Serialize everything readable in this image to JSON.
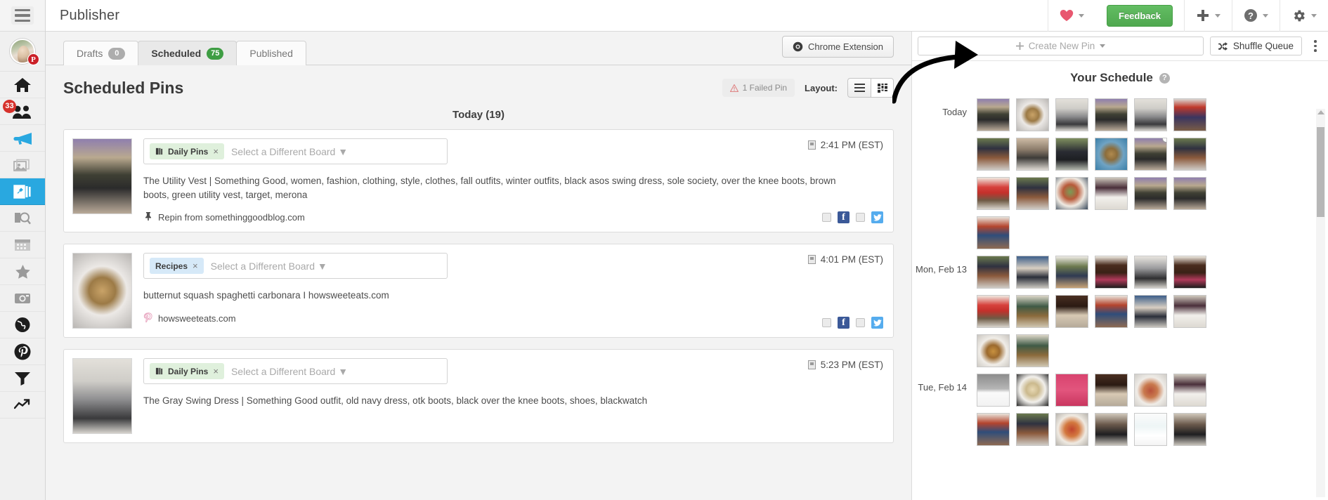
{
  "header": {
    "title": "Publisher",
    "hamburger_icon": "hamburger-menu-icon",
    "heart_icon": "heart-icon",
    "feedback_label": "Feedback",
    "plus_icon": "plus-icon",
    "help_icon": "question-circle-icon",
    "gear_icon": "gear-icon",
    "feedback_color": "#5cb85c",
    "heart_color": "#e8576f"
  },
  "sidebar": {
    "avatar": {
      "name": "user-avatar",
      "badge_icon": "pinterest-badge-icon"
    },
    "items": [
      {
        "name": "home",
        "icon": "home-icon",
        "badge": "",
        "active": false
      },
      {
        "name": "community",
        "icon": "people-icon",
        "badge": "33",
        "active": false
      },
      {
        "name": "announcements",
        "icon": "megaphone-icon",
        "badge": "",
        "active": false
      },
      {
        "name": "image-library",
        "icon": "photos-icon",
        "badge": "",
        "active": false
      },
      {
        "name": "publisher",
        "icon": "pin-board-icon",
        "badge": "",
        "active": true
      },
      {
        "name": "content-search",
        "icon": "content-search-icon",
        "badge": "",
        "active": false
      },
      {
        "name": "calendar",
        "icon": "calendar-icon",
        "badge": "",
        "active": false
      },
      {
        "name": "favorites",
        "icon": "star-icon",
        "badge": "",
        "active": false
      },
      {
        "name": "instagram",
        "icon": "camera-icon",
        "badge": "",
        "active": false
      },
      {
        "name": "web",
        "icon": "globe-icon",
        "badge": "",
        "active": false
      },
      {
        "name": "pinterest",
        "icon": "pinterest-icon",
        "badge": "",
        "active": false
      },
      {
        "name": "filter",
        "icon": "funnel-icon",
        "badge": "",
        "active": false
      },
      {
        "name": "analytics",
        "icon": "trending-up-icon",
        "badge": "",
        "active": false
      }
    ]
  },
  "tabs": [
    {
      "label": "Drafts",
      "count": "0",
      "active": false,
      "count_color": "#adadad"
    },
    {
      "label": "Scheduled",
      "count": "75",
      "active": true,
      "count_color": "#3e9d43"
    },
    {
      "label": "Published",
      "count": "",
      "active": false,
      "count_color": ""
    }
  ],
  "toolbar": {
    "chrome_extension_label": "Chrome Extension",
    "chrome_icon": "chrome-icon"
  },
  "section": {
    "title": "Scheduled Pins",
    "failed_pin_label": "1 Failed Pin",
    "failed_pin_icon": "warning-triangle-icon",
    "layout_label": "Layout:",
    "layout_list_icon": "list-view-icon",
    "layout_grid_icon": "grid-view-icon",
    "day_heading": "Today (19)"
  },
  "pins": [
    {
      "board": "Daily Pins",
      "board_color": "green",
      "board_icon": "pinterest-board-icon",
      "remove_label": "×",
      "board_placeholder": "Select a Different Board",
      "description": "The Utility Vest | Something Good, women, fashion, clothing, style, clothes, fall outfits, winter outfits, black asos swing dress, sole society, over the knee boots, brown boots, green utility vest, target, merona",
      "source_icon": "repin-icon",
      "source": "Repin from somethinggoodblog.com",
      "time": "2:41 PM (EST)",
      "time_icon": "clock-icon",
      "facebook_label": "f",
      "thumb_style": "outfit-green-jacket"
    },
    {
      "board": "Recipes",
      "board_color": "blue",
      "board_icon": "",
      "remove_label": "×",
      "board_placeholder": "Select a Different Board",
      "description": "butternut squash spaghetti carbonara I howsweeteats.com",
      "source_icon": "pinterest-outline-icon",
      "source": "howsweeteats.com",
      "time": "4:01 PM (EST)",
      "time_icon": "clock-icon",
      "facebook_label": "f",
      "thumb_style": "pasta-plate"
    },
    {
      "board": "Daily Pins",
      "board_color": "green",
      "board_icon": "pinterest-board-icon",
      "remove_label": "×",
      "board_placeholder": "Select a Different Board",
      "description": "The Gray Swing Dress | Something Good outfit, old navy dress, otk boots, black over the knee boots, shoes, blackwatch",
      "source_icon": "repin-icon",
      "source": "",
      "time": "5:23 PM (EST)",
      "time_icon": "clock-icon",
      "facebook_label": "f",
      "thumb_style": "outfit-gray-dress"
    }
  ],
  "schedule": {
    "create_pin_label": "Create New Pin",
    "create_pin_icon": "plus-icon",
    "shuffle_label": "Shuffle Queue",
    "shuffle_icon": "shuffle-icon",
    "kebab_icon": "more-vertical-icon",
    "title": "Your Schedule",
    "help_icon": "question-mark-icon",
    "days": [
      {
        "label": "Today",
        "rows": [
          [
            "outfit-green-jacket",
            "pasta-plate",
            "outfit-gray-dress",
            "outfit-green-jacket",
            "outfit-gray-dress",
            "red-hat-sitting"
          ],
          [
            "boots-brown",
            "street-walk",
            "boots-black-step",
            "bowl-blue-plate",
            "outfit-green-jacket",
            "boots-brown"
          ],
          [
            "strawberry-dessert",
            "boots-brown",
            "plate-breakfast",
            "white-pants-outfit",
            "outfit-green-jacket",
            "outfit-green-jacket"
          ],
          [
            "plaid-bag-jeans"
          ]
        ]
      },
      {
        "label": "Mon, Feb 13",
        "rows": [
          [
            "boots-brown",
            "blue-door-outfit",
            "green-jacket-walk",
            "chocolate-dessert",
            "gray-dress-walk",
            "chocolate-dessert"
          ],
          [
            "strawberry-dessert",
            "green-coat-field",
            "dark-doorway",
            "plaid-bag-jeans",
            "blue-door-outfit",
            "white-pants-outfit"
          ],
          [
            "sweet-potato-plate",
            "green-coat-field"
          ]
        ]
      },
      {
        "label": "Tue, Feb 14",
        "rows": [
          [
            "seo-essentials-pin",
            "cookies-plate",
            "seo-pink-pin",
            "dark-doorway",
            "pasta-bowl-white",
            "white-pants-outfit"
          ],
          [
            "plaid-bag-jeans",
            "boots-brown",
            "pizza-plate",
            "black-dress-street",
            "numbered-list-pin",
            "black-dress-street"
          ]
        ]
      }
    ]
  }
}
